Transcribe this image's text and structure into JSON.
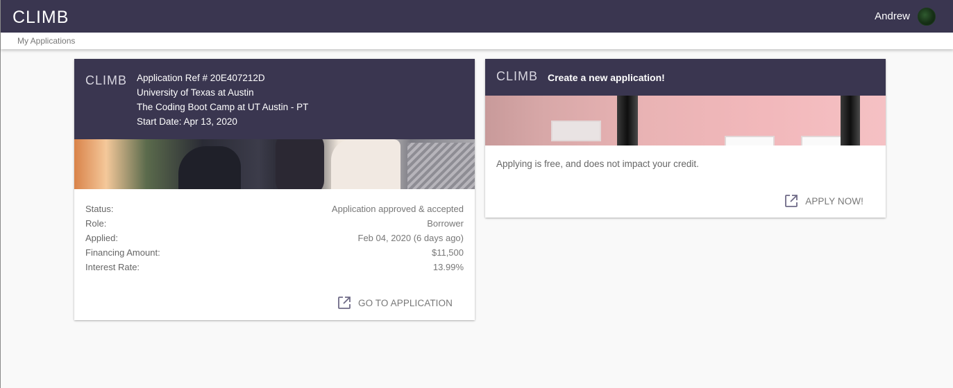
{
  "header": {
    "brand": "CLIMB",
    "user_name": "Andrew"
  },
  "nav": {
    "breadcrumb": "My Applications"
  },
  "application_card": {
    "brand": "CLIMB",
    "ref": "Application Ref # 20E407212D",
    "school": "University of Texas at Austin",
    "program": "The Coding Boot Camp at UT Austin - PT",
    "start_date": "Start Date: Apr 13, 2020",
    "details": [
      {
        "label": "Status:",
        "value": "Application approved & accepted"
      },
      {
        "label": "Role:",
        "value": "Borrower"
      },
      {
        "label": "Applied:",
        "value": "Feb 04, 2020 (6 days ago)"
      },
      {
        "label": "Financing Amount:",
        "value": "$11,500"
      },
      {
        "label": "Interest Rate:",
        "value": "13.99%"
      }
    ],
    "action_label": "GO TO APPLICATION",
    "action_icon": "open-in-new-icon"
  },
  "new_card": {
    "brand": "CLIMB",
    "title": "Create a new application!",
    "body": "Applying is free, and does not impact your credit.",
    "action_label": "APPLY NOW!",
    "action_icon": "open-in-new-icon"
  },
  "colors": {
    "header_bg": "#3a3650",
    "page_bg": "#f9f9f9",
    "accent": "#6e6a86"
  }
}
